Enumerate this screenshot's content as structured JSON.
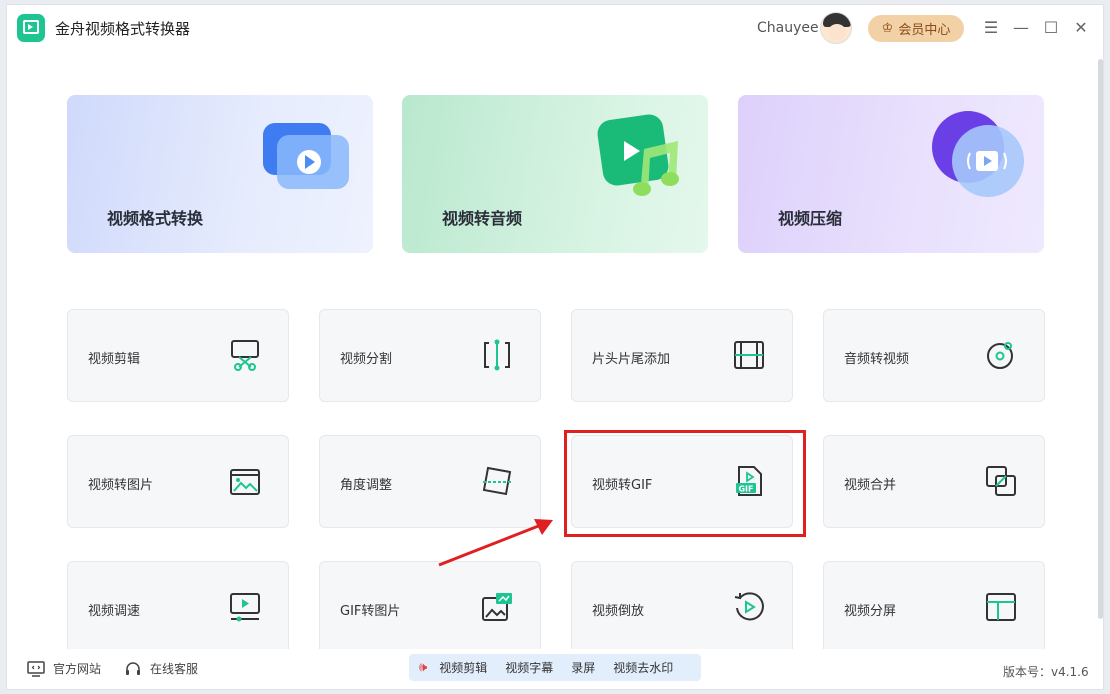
{
  "app": {
    "title": "金舟视频格式转换器"
  },
  "header": {
    "username": "Chauyee",
    "vip_label": "会员中心"
  },
  "big_cards": [
    {
      "label": "视频格式转换",
      "icon": "video-play-icon"
    },
    {
      "label": "视频转音频",
      "icon": "music-note-icon"
    },
    {
      "label": "视频压缩",
      "icon": "compress-icon"
    }
  ],
  "tools": [
    {
      "label": "视频剪辑",
      "icon": "scissors-icon"
    },
    {
      "label": "视频分割",
      "icon": "split-icon"
    },
    {
      "label": "片头片尾添加",
      "icon": "film-icon"
    },
    {
      "label": "音频转视频",
      "icon": "audio-disc-icon"
    },
    {
      "label": "视频转图片",
      "icon": "image-icon"
    },
    {
      "label": "角度调整",
      "icon": "rotate-frame-icon"
    },
    {
      "label": "视频转GIF",
      "icon": "gif-file-icon"
    },
    {
      "label": "视频合并",
      "icon": "merge-icon"
    },
    {
      "label": "视频调速",
      "icon": "speed-screen-icon"
    },
    {
      "label": "GIF转图片",
      "icon": "gif-image-icon"
    },
    {
      "label": "视频倒放",
      "icon": "reverse-play-icon"
    },
    {
      "label": "视频分屏",
      "icon": "split-screen-icon"
    }
  ],
  "footer": {
    "site_label": "官方网站",
    "service_label": "在线客服",
    "promo_items": [
      "视频剪辑",
      "视频字幕",
      "录屏",
      "视频去水印"
    ],
    "version": "版本号：v4.1.6"
  },
  "colors": {
    "accent": "#1ec592",
    "vip_bg": "#f1d1a5",
    "highlight": "#e02020"
  }
}
